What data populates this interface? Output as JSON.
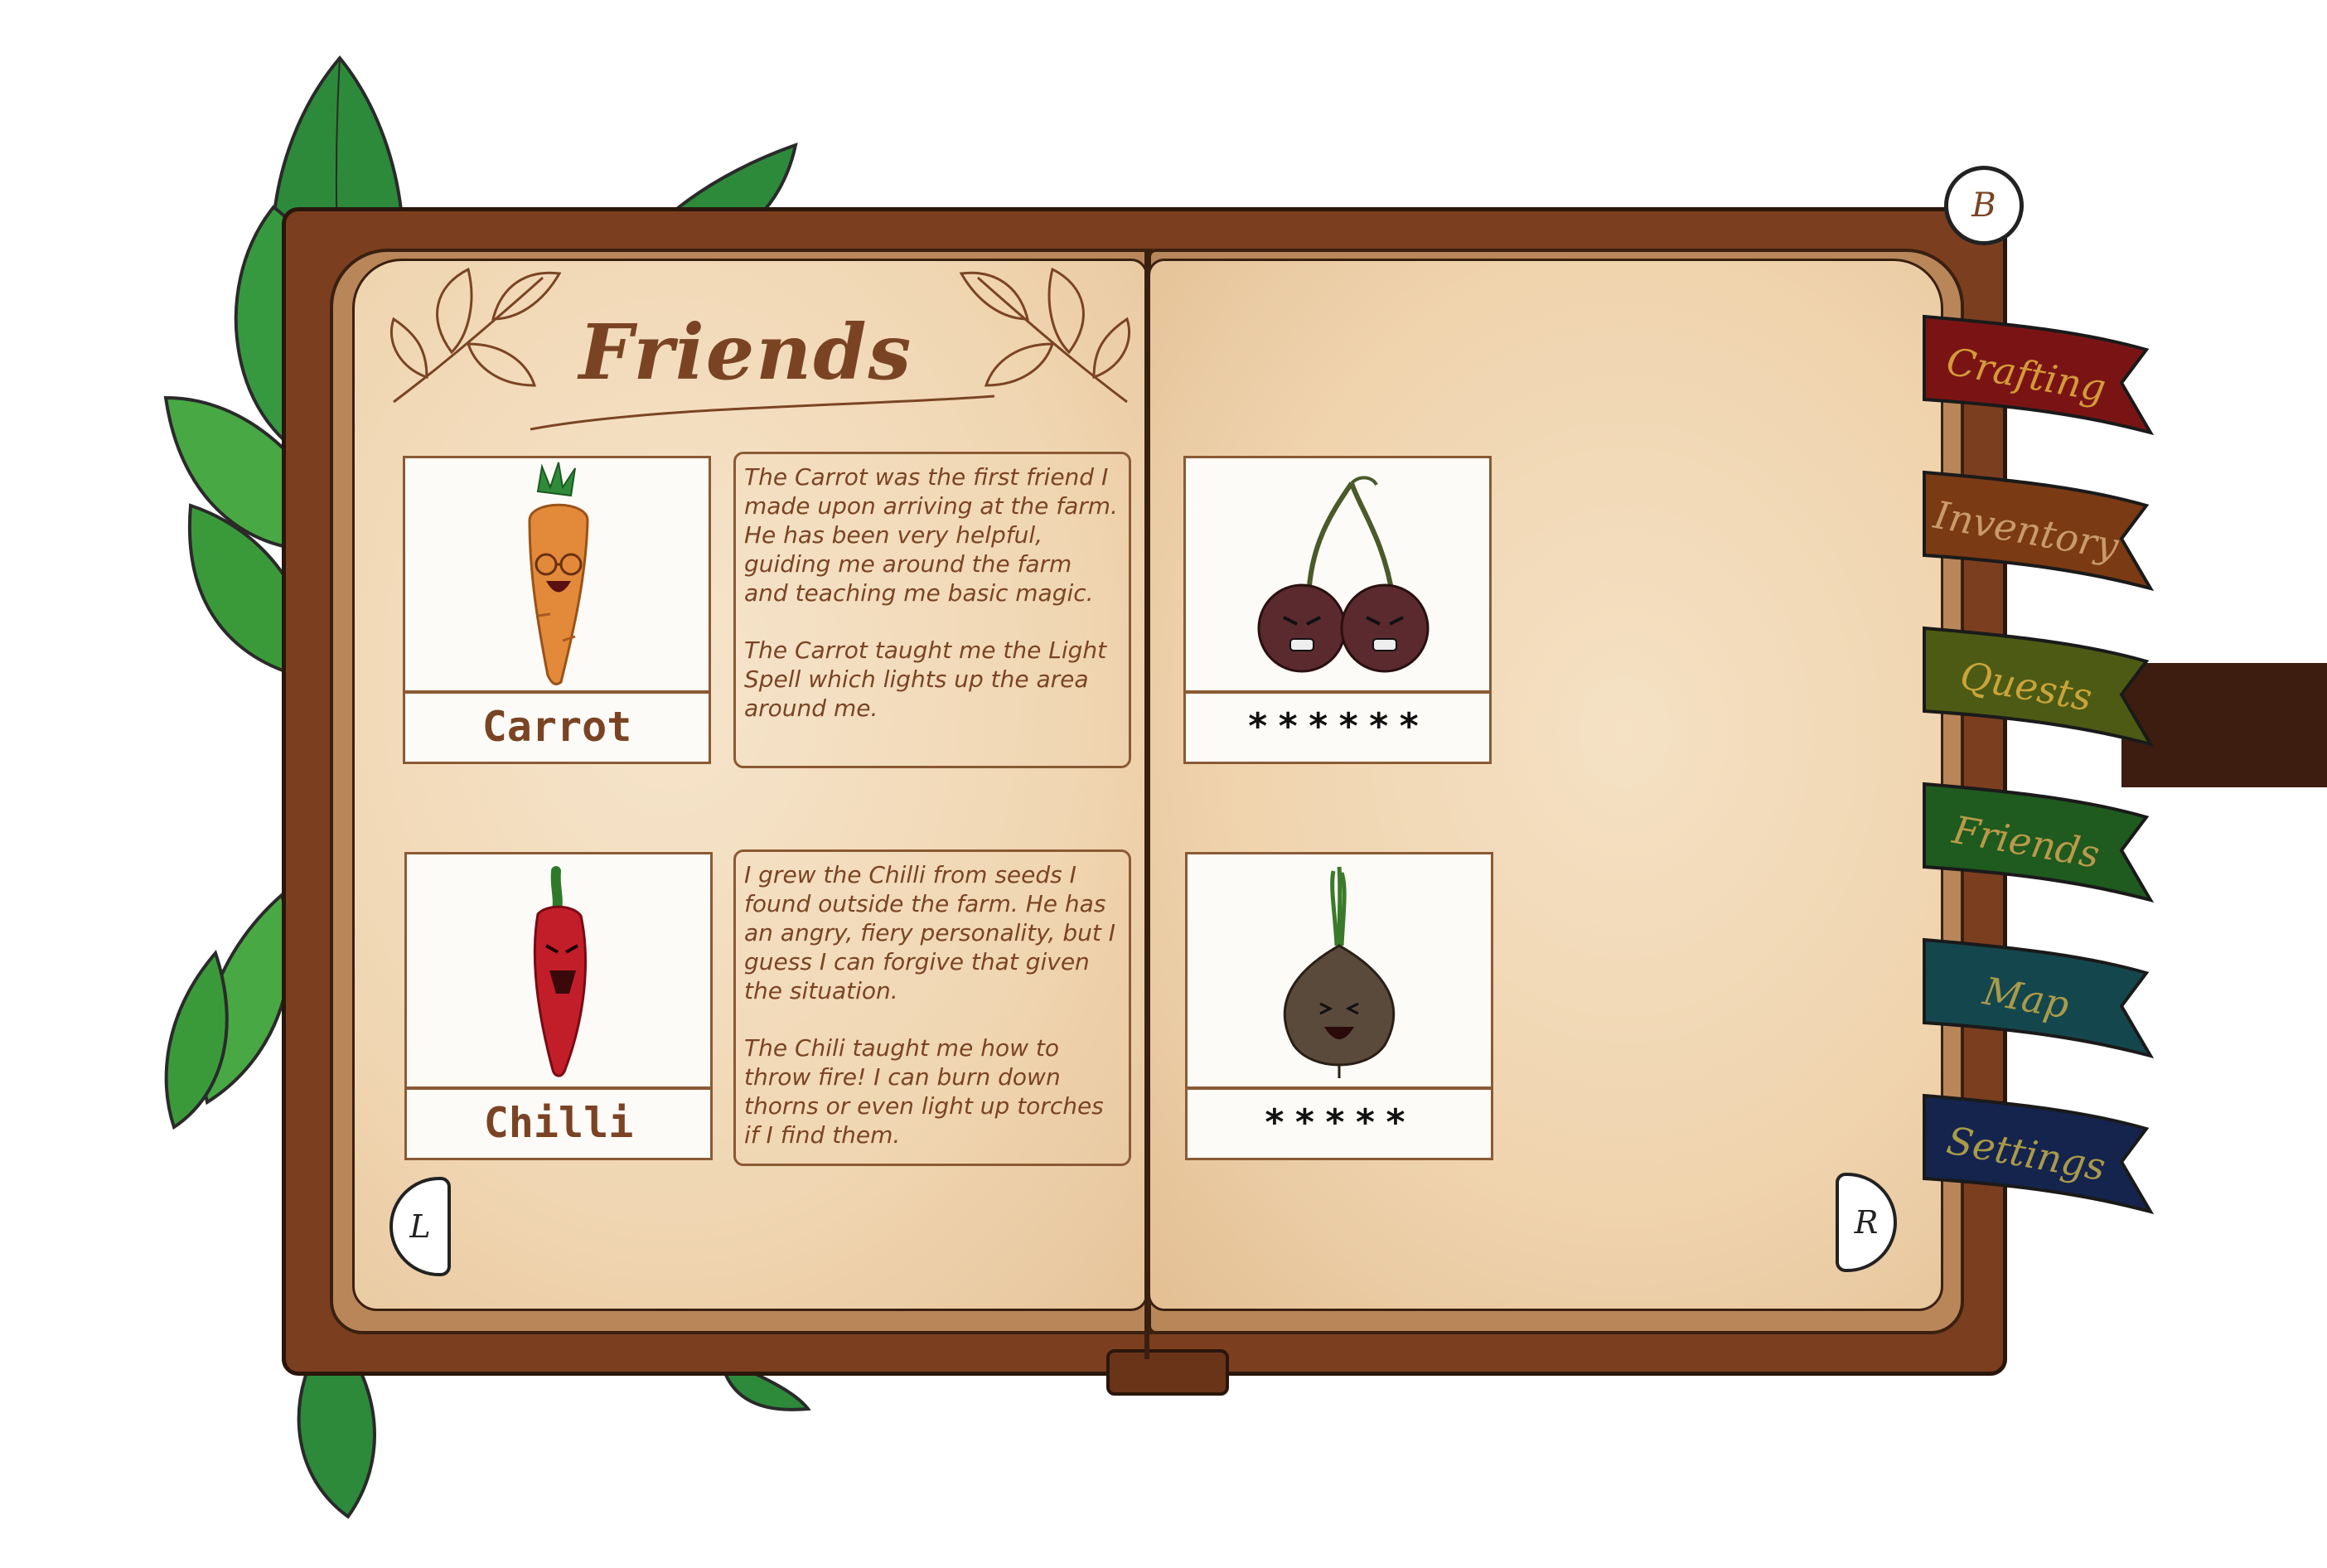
{
  "page": {
    "title": "Friends",
    "back_button": "B",
    "nav_left": "L",
    "nav_right": "R"
  },
  "friends": [
    {
      "name": "Carrot",
      "description": [
        "The Carrot was the first friend I made upon arriving at the farm. He has been very helpful, guiding me around the farm and teaching me basic magic.",
        "The Carrot taught me the Light Spell which lights up the area around me."
      ]
    },
    {
      "name": "Chilli",
      "description": [
        "I grew the Chilli from seeds I found outside the farm. He has an angry, fiery personality, but I guess I can forgive that given the situation.",
        "The Chili taught me how to throw fire! I can burn down thorns or even light up torches if I find them."
      ]
    },
    {
      "name": "******",
      "locked": true,
      "icon": "cherries-icon"
    },
    {
      "name": "*****",
      "locked": true,
      "icon": "onion-icon"
    }
  ],
  "tabs": [
    {
      "label": "Crafting",
      "color": "#7a1414",
      "text_color": "#d49a3a"
    },
    {
      "label": "Inventory",
      "color": "#7a3a14",
      "text_color": "#c99a6a"
    },
    {
      "label": "Quests",
      "color": "#4d5a14",
      "text_color": "#c9a43a"
    },
    {
      "label": "Friends",
      "color": "#1f5a1f",
      "text_color": "#b99a4a"
    },
    {
      "label": "Map",
      "color": "#14474d",
      "text_color": "#a99a4a"
    },
    {
      "label": "Settings",
      "color": "#14244d",
      "text_color": "#a99a4a"
    }
  ]
}
